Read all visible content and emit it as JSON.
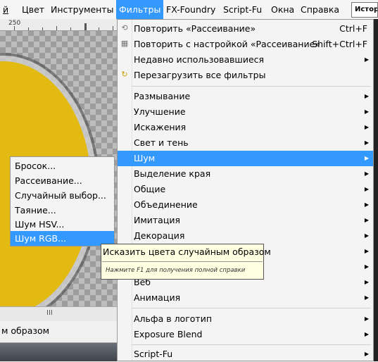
{
  "menubar": {
    "items": [
      {
        "label": "й"
      },
      {
        "label": "Цвет"
      },
      {
        "label": "Инструменты"
      },
      {
        "label": "Фильтры"
      },
      {
        "label": "FX-Foundry"
      },
      {
        "label": "Script-Fu"
      },
      {
        "label": "Окна"
      },
      {
        "label": "Справка"
      }
    ],
    "history_tab": "Истор"
  },
  "canvas": {
    "ruler_label": "250",
    "scroll_grip": "III",
    "status_text": "м образом"
  },
  "filters_menu": {
    "items": [
      {
        "label": "Повторить «Рассеивание»",
        "shortcut": "Ctrl+F",
        "icon": "repeat-filter-icon"
      },
      {
        "label": "Повторить с настройкой «Рассеивание»",
        "shortcut": "Shift+Ctrl+F",
        "icon": "reshow-filter-icon"
      },
      {
        "label": "Недавно использовавшиеся",
        "arrow": "▶"
      },
      {
        "label": "Перезагрузить все фильтры",
        "icon": "reload-filters-icon"
      },
      {
        "label": "Размывание",
        "arrow": "▶"
      },
      {
        "label": "Улучшение",
        "arrow": "▶"
      },
      {
        "label": "Искажения",
        "arrow": "▶"
      },
      {
        "label": "Свет и тень",
        "arrow": "▶"
      },
      {
        "label": "Шум",
        "arrow": "▶"
      },
      {
        "label": "Выделение края",
        "arrow": "▶"
      },
      {
        "label": "Общие",
        "arrow": "▶"
      },
      {
        "label": "Объединение",
        "arrow": "▶"
      },
      {
        "label": "Имитация",
        "arrow": "▶"
      },
      {
        "label": "Декорация",
        "arrow": "▶"
      },
      {
        "label": "",
        "arrow": "▶"
      },
      {
        "label": "",
        "arrow": "▶"
      },
      {
        "label": "Веб",
        "arrow": "▶"
      },
      {
        "label": "Анимация",
        "arrow": "▶"
      },
      {
        "label": "Альфа в логотип",
        "arrow": "▶"
      },
      {
        "label": "Exposure Blend",
        "arrow": "▶"
      },
      {
        "label": "Script-Fu",
        "arrow": "▶"
      }
    ]
  },
  "noise_submenu": {
    "items": [
      {
        "label": "Бросок..."
      },
      {
        "label": "Рассеивание..."
      },
      {
        "label": "Случайный выбор..."
      },
      {
        "label": "Таяние..."
      },
      {
        "label": "Шум HSV..."
      },
      {
        "label": "Шум RGB..."
      }
    ]
  },
  "tooltip": {
    "main": "Исказить цвета случайным образом",
    "hint": "Нажмите F1 для получения полной справки"
  },
  "colors": {
    "highlight": "#3399ff",
    "menu_bg": "#f4f4f4",
    "tooltip_bg": "#ffffe1",
    "canvas_yellow": "#e2ba12"
  }
}
